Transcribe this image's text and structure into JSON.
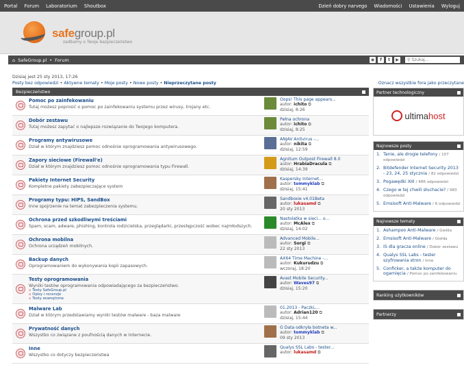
{
  "topbar": {
    "left": [
      "Portal",
      "Forum",
      "Laboratorium",
      "Shoutbox"
    ],
    "right": [
      "Dzień dobry narvego",
      "Wiadomości",
      "Ustawienia",
      "Wyloguj"
    ]
  },
  "header": {
    "brand_main": "safe",
    "brand_rest": "group.pl",
    "tagline": "zadbamy o Twoje bezpieczeństwo"
  },
  "crumb": {
    "home": "SafeGroup.pl",
    "sep": "•",
    "forum": "Forum"
  },
  "social": [
    "rss-icon",
    "facebook-icon",
    "tumblr-icon",
    "youtube-icon"
  ],
  "search": {
    "placeholder": "Szukaj..."
  },
  "dateline": "Dzisiaj jest 25 sty 2013, 17:26",
  "quicklinks": [
    "Posty bez odpowiedzi",
    "Aktywne tematy",
    "Moje posty",
    "Nowe posty",
    "Nieprzeczytane posty"
  ],
  "mark_read": "Oznacz wszystkie fora jako przeczytane",
  "category": "Bezpieczeństwo",
  "forums": [
    {
      "title": "Pomoc po zainfekowaniu",
      "desc": "Tutaj możesz poprosić o pomoc po zainfekowaniu systemu przez wirusy, trojany etc.",
      "lp_title": "Oops! This page appears...",
      "lp_author": "ichito",
      "lp_date": "dzisiaj, 8:26",
      "av": "#6b8a3a",
      "ac": ""
    },
    {
      "title": "Dobór zestawu",
      "desc": "Tutaj możesz zapytać o najlepsze rozwiązanie do Twojego komputera.",
      "lp_title": "Pełna ochrona",
      "lp_author": "ichito",
      "lp_date": "dzisiaj, 8:25",
      "av": "#6b8a3a",
      "ac": ""
    },
    {
      "title": "Programy antywirusowe",
      "desc": "Dział w którym znajdziesz pomoc odnośnie oprogramowania antywirusowego.",
      "lp_title": "ANJAV Antivirus -...",
      "lp_author": "nikita",
      "lp_date": "dzisiaj, 12:59",
      "av": "#5a6e96",
      "ac": ""
    },
    {
      "title": "Zapory sieciowe (Firewall'e)",
      "desc": "Dział w którym znajdziesz pomoc odnośnie oprogramowania typu Firewall.",
      "lp_title": "Agnitum Outpost Firewall 8.0",
      "lp_author": "HrabiaDracula",
      "lp_date": "dzisiaj, 14:39",
      "av": "#d49a1a",
      "ac": ""
    },
    {
      "title": "Pakiety Internet Security",
      "desc": "Kompletne pakiety zabezpieczające system",
      "lp_title": "Kaspersky Internet...",
      "lp_author": "tommyklab",
      "lp_date": "dzisiaj, 15:41",
      "av": "#a0704a",
      "ac": "blue"
    },
    {
      "title": "Programy typu: HIPS, SandBox",
      "desc": "Inne spojrzenie na temat zabezpieczenia systemu.",
      "lp_title": "Sandboxie v4.01Beta",
      "lp_author": "lukasamd",
      "lp_date": "20 sty 2013",
      "av": "#666",
      "ac": "red"
    },
    {
      "title": "Ochrona przed szkodliwymi treściami",
      "desc": "Spam, scam, adware, phishing, kontrola rodzicielska, przeglądarki, przestępczość wobec najmłodszych.",
      "lp_title": "Nastolatka w sieci... o...",
      "lp_author": "McAlex",
      "lp_date": "dzisiaj, 14:02",
      "av": "#2a8a2a",
      "ac": ""
    },
    {
      "title": "Ochrona mobilna",
      "desc": "Ochrona urządzeń mobilnych.",
      "lp_title": "Advanced Mobile...",
      "lp_author": "Sorgi",
      "lp_date": "22 sty 2013",
      "av": "#bbb",
      "ac": ""
    },
    {
      "title": "Backup danych",
      "desc": "Oprogramowaniem do wykonywania kopii zapasowych.",
      "lp_title": "AX64 Time Machine -...",
      "lp_author": "Kukurudzu",
      "lp_date": "wczoraj, 18:20",
      "av": "#bbb",
      "ac": ""
    },
    {
      "title": "Testy oprogramowania",
      "desc": "Wyniki testów oprogramowania odpowiadającego za bezpieczeństwo.",
      "subs": [
        "Testy SafeGroup.pl",
        "Opisy i recenzje",
        "Testy zewnętrzne"
      ],
      "lp_title": "Avast Mobile Security...",
      "lp_author": "Waves97",
      "lp_date": "dzisiaj, 15:20",
      "av": "#444",
      "ac": "blue"
    },
    {
      "title": "Malware Lab",
      "desc": "Dział w którym przedstawiamy wyniki testów malware - baza malware",
      "lp_title": "01.2013 - Paczki,...",
      "lp_author": "Adrian120",
      "lp_date": "dzisiaj, 15:44",
      "av": "#bbb",
      "ac": ""
    },
    {
      "title": "Prywatność danych",
      "desc": "Wszystko co związane z poufnością danych w Internecie.",
      "lp_title": "G Data odkryła botneta w...",
      "lp_author": "tommyklab",
      "lp_date": "09 sty 2013",
      "av": "#a0704a",
      "ac": "blue"
    },
    {
      "title": "Inne",
      "desc": "Wszystko co dotyczy bezpieczeństwa",
      "lp_title": "Qualys SSL Labs - tester...",
      "lp_author": "lukasamd",
      "lp_date": "",
      "av": "#666",
      "ac": "red"
    }
  ],
  "labels": {
    "author": "autor:"
  },
  "sidebar": {
    "partner_head": "Partner technologiczny",
    "partner_name_a": "ultima",
    "partner_name_b": "host",
    "posts_head": "Najnowsze posty",
    "posts": [
      {
        "n": "1.",
        "title": "Tanie, ale drogie telefony",
        "meta": "/ 107 odpowiedzi"
      },
      {
        "n": "2.",
        "title": "Bitdefender Internet Security 2013 - 23, 24, 25 stycznia",
        "meta": "/ 82 odpowiedzi"
      },
      {
        "n": "3.",
        "title": "Pogawędki XIII",
        "meta": "/ 486 odpowiedzi"
      },
      {
        "n": "4.",
        "title": "Czego w tej chwili słuchacie?",
        "meta": "/ 983 odpowiedzi"
      },
      {
        "n": "5.",
        "title": "Emsisoft Anti-Malware",
        "meta": "/ 6 odpowiedzi"
      }
    ],
    "topics_head": "Najnowsze tematy",
    "topics": [
      {
        "n": "1.",
        "title": "Ashampoo Anti-Malware",
        "meta": "/ Giełda"
      },
      {
        "n": "2.",
        "title": "Emsisoft Anti-Malware",
        "meta": "/ Giełda"
      },
      {
        "n": "3.",
        "title": "IS dla gracza online",
        "meta": "/ Dobór zestawu"
      },
      {
        "n": "4.",
        "title": "Qualys SSL Labs - tester szyfrowania stron",
        "meta": "/ Inne"
      },
      {
        "n": "5.",
        "title": "Conficker, a także komputer do ogarnięcia",
        "meta": "/ Pomoc po zainfekowaniu"
      }
    ],
    "ranking_head": "Ranking użytkowników",
    "partners_head": "Partnerzy"
  }
}
